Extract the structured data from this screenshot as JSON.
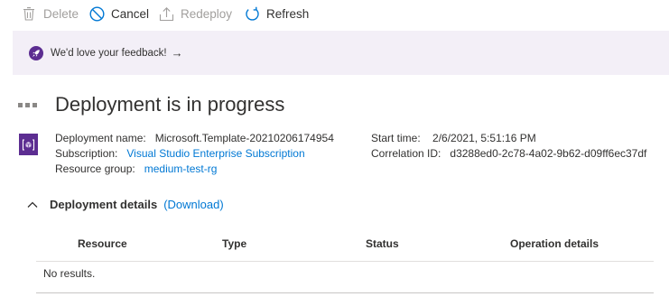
{
  "toolbar": {
    "delete_label": "Delete",
    "cancel_label": "Cancel",
    "redeploy_label": "Redeploy",
    "refresh_label": "Refresh"
  },
  "feedback": {
    "text": "We'd love your feedback!",
    "arrow": "→"
  },
  "page": {
    "title": "Deployment is in progress"
  },
  "details": {
    "deployment_name_label": "Deployment name:",
    "deployment_name_value": "Microsoft.Template-20210206174954",
    "subscription_label": "Subscription:",
    "subscription_value": "Visual Studio Enterprise Subscription",
    "resource_group_label": "Resource group:",
    "resource_group_value": "medium-test-rg",
    "start_time_label": "Start time:",
    "start_time_value": "2/6/2021, 5:51:16 PM",
    "correlation_id_label": "Correlation ID:",
    "correlation_id_value": "d3288ed0-2c78-4a02-9b62-d09ff6ec37df"
  },
  "deployment_details": {
    "header_label": "Deployment details",
    "download_label": "(Download)"
  },
  "table": {
    "columns": [
      "Resource",
      "Type",
      "Status",
      "Operation details"
    ],
    "empty_text": "No results."
  },
  "colors": {
    "accent": "#0078d4",
    "brand_purple": "#5c2d91",
    "feedback_bg": "#f3eff7",
    "disabled": "#a19f9d"
  },
  "icons": {
    "delete": "trash-icon",
    "cancel": "cancel-icon",
    "redeploy": "upload-icon",
    "refresh": "refresh-icon",
    "feedback": "rocket-icon",
    "resource": "template-icon",
    "collapse": "chevron-up-icon",
    "progress": "loading-dots-icon"
  }
}
